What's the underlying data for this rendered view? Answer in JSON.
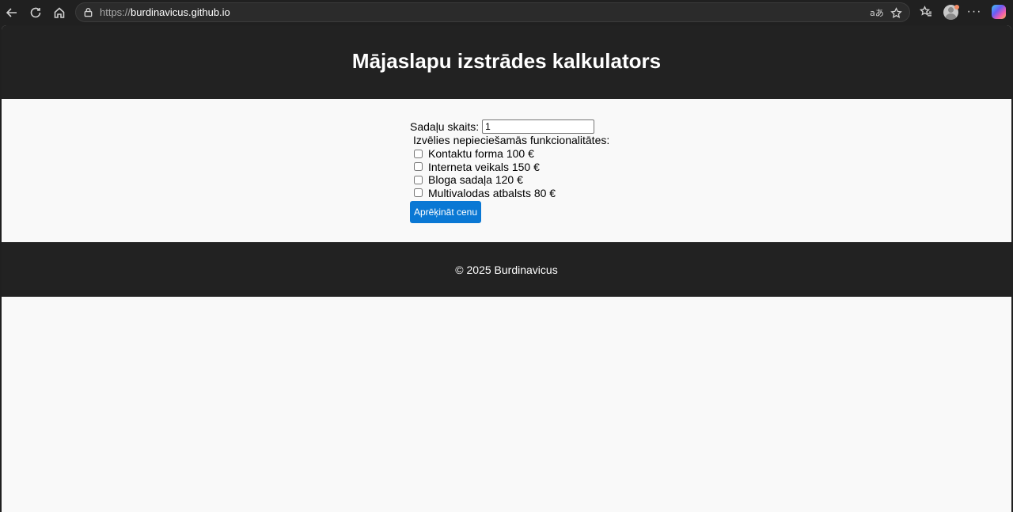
{
  "browser": {
    "url_scheme": "https://",
    "url_host": "burdinavicus.github.io",
    "icons": [
      "back-icon",
      "reload-icon",
      "home-icon",
      "lock-icon",
      "translate-icon",
      "star-icon",
      "favorites-icon",
      "profile-icon",
      "more-icon",
      "copilot-icon"
    ],
    "translate_glyph": "aあ",
    "more_glyph": "···"
  },
  "header": {
    "title": "Mājaslapu izstrādes kalkulators"
  },
  "form": {
    "sections_label": "Sadaļu skaits:",
    "sections_value": "1",
    "features_label": "Izvēlies nepieciešamās funkcionalitātes:",
    "features": [
      {
        "label": "Kontaktu forma 100 €",
        "checked": false
      },
      {
        "label": "Interneta veikals 150 €",
        "checked": false
      },
      {
        "label": "Bloga sadaļa 120 €",
        "checked": false
      },
      {
        "label": "Multivalodas atbalsts 80 €",
        "checked": false
      }
    ],
    "calculate_label": "Aprēķināt cenu"
  },
  "footer": {
    "text": "© 2025 Burdinavicus"
  },
  "colors": {
    "chrome_bg": "#202020",
    "page_bg": "#f9f9f9",
    "header_bg": "#222222",
    "button_bg": "#0a78d4"
  }
}
